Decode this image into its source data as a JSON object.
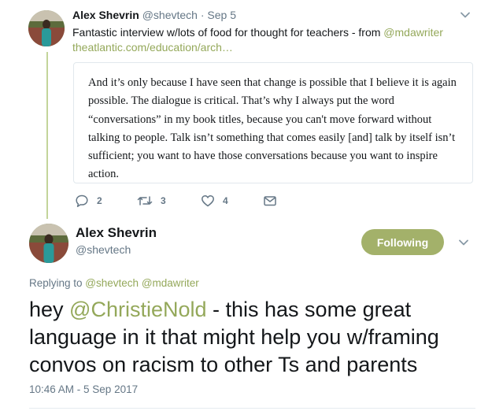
{
  "parent_tweet": {
    "name": "Alex Shevrin",
    "handle": "@shevtech",
    "separator": " · ",
    "date": "Sep 5",
    "text_before": "Fantastic interview w/lots of food for thought for teachers  - from ",
    "mention": "@mdawriter",
    "url": "theatlantic.com/education/arch…",
    "quote": "And it’s only because I have seen that change is possible that I believe it is again possible. The dialogue is critical. That’s why I always put the word “conversations” in my book titles, because you can't move forward without talking to people. Talk isn’t something that comes easily [and] talk by itself isn’t sufficient; you want to have those conversations because you want to inspire action.",
    "actions": {
      "reply_count": "2",
      "retweet_count": "3",
      "like_count": "4"
    }
  },
  "main_tweet": {
    "name": "Alex Shevrin",
    "handle": "@shevtech",
    "follow_label": "Following",
    "replying_prefix": "Replying to ",
    "replying_to_1": "@shevtech",
    "replying_to_2": "@mdawriter",
    "text_before": "hey ",
    "mention": "@ChristieNold",
    "text_after": "  - this has some great language in it that might help you w/framing convos on racism to other Ts and parents",
    "timestamp": "10:46 AM - 5 Sep 2017"
  },
  "colors": {
    "accent": "#94a85a",
    "follow_button": "#a3b16a",
    "thread_line": "#c3d49a",
    "muted_text": "#657786"
  },
  "icons": {
    "reply": "reply-icon",
    "retweet": "retweet-icon",
    "like": "heart-icon",
    "dm": "envelope-icon",
    "menu": "chevron-down-icon"
  }
}
